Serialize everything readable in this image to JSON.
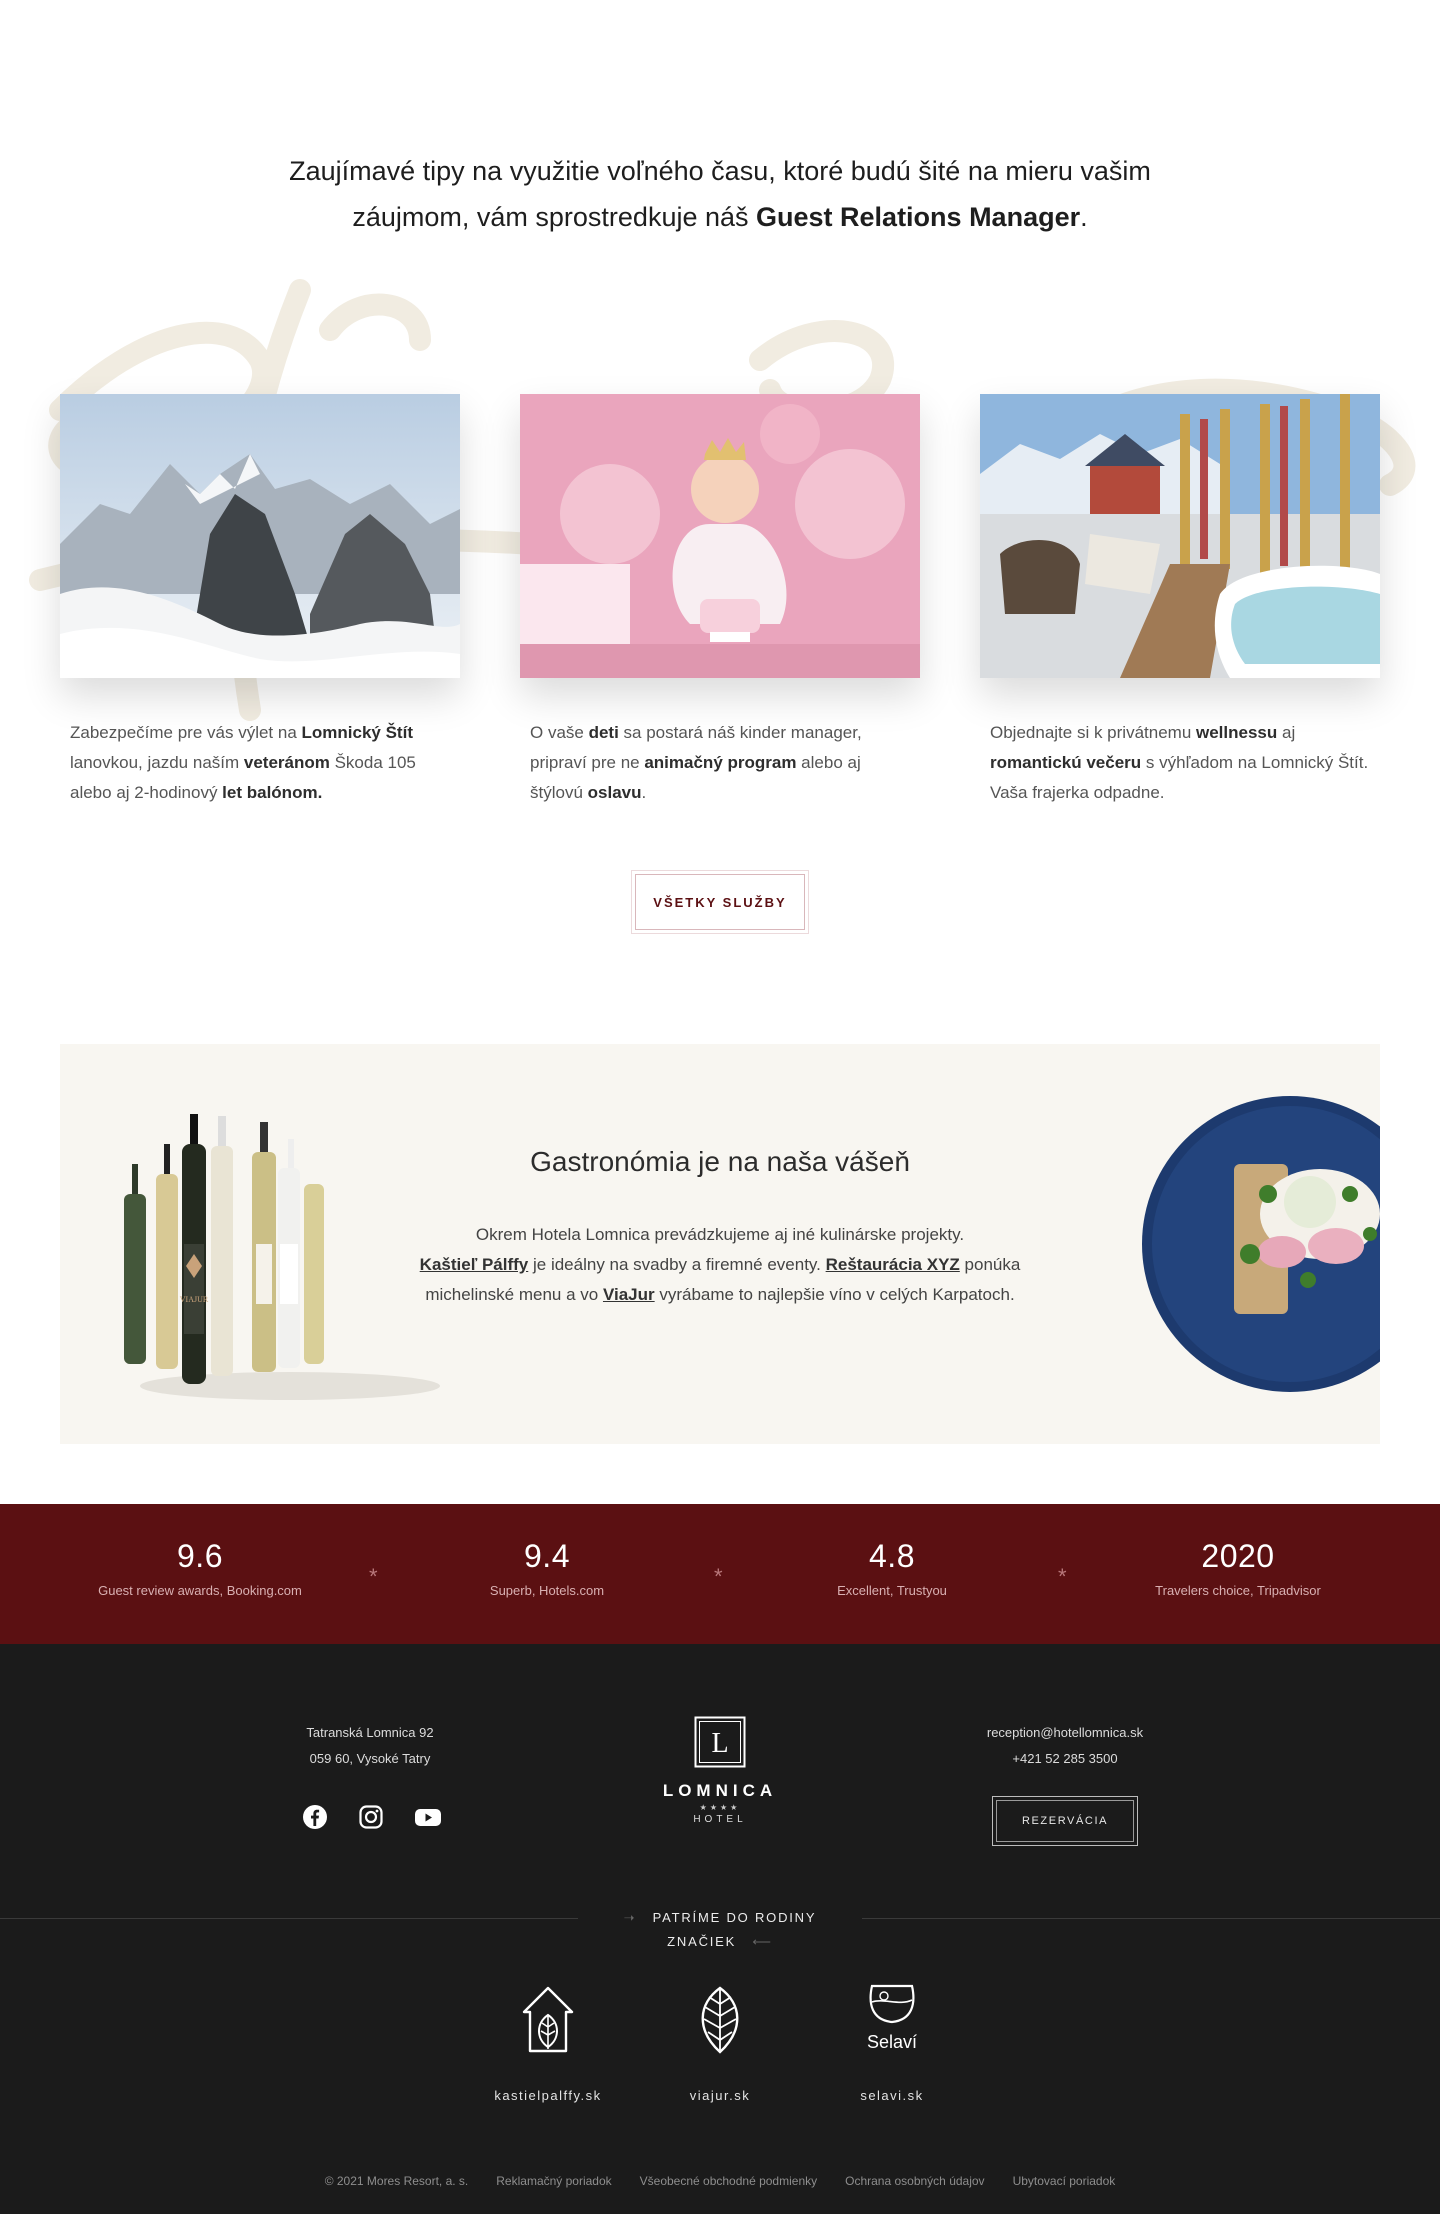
{
  "intro": {
    "line1": "Zaujímavé tipy na využitie voľného času, ktoré budú šité na mieru vašim",
    "line2_pre": "záujmom, vám sprostredkuje náš ",
    "line2_bold": "Guest Relations Manager",
    "line2_post": "."
  },
  "cards": [
    {
      "image": "mountain-peaks-photo",
      "t1": "Zabezpečíme pre vás výlet na ",
      "b1": "Lomnický Štít",
      "t2": " lanovkou, jazdu naším ",
      "b2": "veteránom",
      "t3": " Škoda 105 alebo aj 2-hodinový ",
      "b3": "let balónom.",
      "t4": ""
    },
    {
      "image": "kids-birthday-photo",
      "t1": "O vaše ",
      "b1": "deti",
      "t2": " sa postará náš kinder manager, pripraví pre ne ",
      "b2": "animačný program",
      "t3": " alebo aj štýlovú ",
      "b3": "oslavu",
      "t4": "."
    },
    {
      "image": "wellness-terrace-photo",
      "t1": "Objednajte si k privátnemu ",
      "b1": "wellnessu",
      "t2": " aj ",
      "b2": "romantickú večeru",
      "t3": " s výhľadom na Lomnický Štít. Vaša frajerka odpadne.",
      "b3": "",
      "t4": ""
    }
  ],
  "services_button": "VŠETKY SLUŽBY",
  "gastro": {
    "title": "Gastronómia je na naša vášeň",
    "p1": "Okrem Hotela Lomnica prevádzkujeme aj iné kulinárske projekty.",
    "link1": "Kaštieľ Pálffy",
    "p2": " je ideálny na svadby a firemné eventy. ",
    "link2": "Reštaurácia XYZ",
    "p3": " ponúka michelinské menu a vo ",
    "link3": "ViaJur",
    "p4": " vyrábame to najlepšie víno v celých Karpatoch.",
    "bottle_label": "VIAJUR"
  },
  "ratings": [
    {
      "score": "9.6",
      "label": "Guest review awards, Booking.com"
    },
    {
      "score": "9.4",
      "label": "Superb, Hotels.com"
    },
    {
      "score": "4.8",
      "label": "Excellent, Trustyou"
    },
    {
      "score": "2020",
      "label": "Travelers choice, Tripadvisor"
    }
  ],
  "rating_separator": "*",
  "footer": {
    "address_line1": "Tatranská Lomnica 92",
    "address_line2": "059 60, Vysoké Tatry",
    "socials": [
      "facebook-icon",
      "instagram-icon",
      "youtube-icon"
    ],
    "logo_letter": "L",
    "logo_word": "LOMNICA",
    "logo_stars": "★★★★",
    "logo_sub": "HOTEL",
    "email": "reception@hotellomnica.sk",
    "phone": "+421 52 285 3500",
    "reservation_button": "REZERVÁCIA",
    "family_heading": "PATRÍME DO RODINY ZNAČIEK",
    "brands": [
      {
        "icon": "house-leaf-icon",
        "name": "kastielpalffy.sk"
      },
      {
        "icon": "leaf-icon",
        "name": "viajur.sk"
      },
      {
        "icon": "wine-glass-icon",
        "name": "selavi.sk",
        "logo_text": "Selaví"
      }
    ],
    "legal": [
      "© 2021 Mores Resort, a. s.",
      "Reklamačný poriadok",
      "Všeobecné obchodné podmienky",
      "Ochrana osobných údajov",
      "Ubytovací poriadok"
    ]
  },
  "colors": {
    "brand": "#5b1012",
    "footer": "#1b1b1b",
    "cream": "#f8f6f1"
  }
}
